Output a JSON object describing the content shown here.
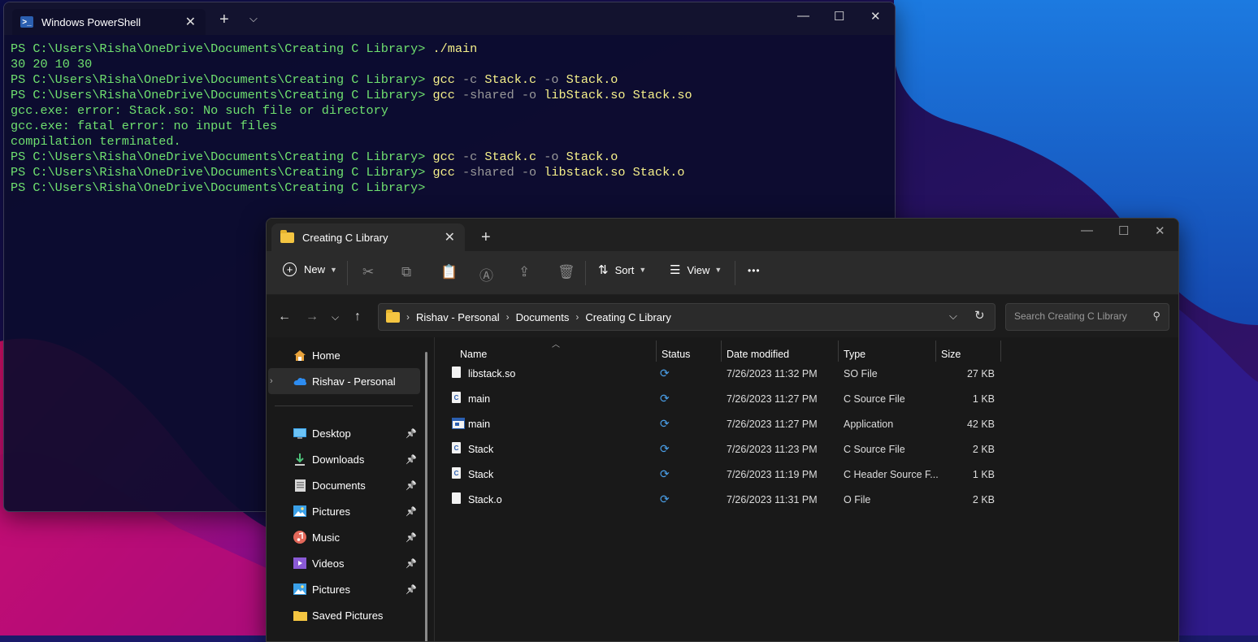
{
  "terminal": {
    "tab_title": "Windows PowerShell",
    "new_tab_glyph": "+",
    "dropdown_glyph": "⌵",
    "lines": [
      {
        "prompt": "PS C:\\Users\\Risha\\OneDrive\\Documents\\Creating C Library> ",
        "cmd": "./main",
        "args": ""
      },
      {
        "prompt": "30 20 10 30",
        "cmd": "",
        "args": ""
      },
      {
        "prompt": "PS C:\\Users\\Risha\\OneDrive\\Documents\\Creating C Library> ",
        "cmd": "gcc",
        "args": " -c Stack.c -o Stack.o"
      },
      {
        "prompt": "PS C:\\Users\\Risha\\OneDrive\\Documents\\Creating C Library> ",
        "cmd": "gcc",
        "args": " -shared -o libStack.so Stack.so"
      },
      {
        "prompt": "gcc.exe: error: Stack.so: No such file or directory",
        "cmd": "",
        "args": ""
      },
      {
        "prompt": "gcc.exe: fatal error: no input files",
        "cmd": "",
        "args": ""
      },
      {
        "prompt": "compilation terminated.",
        "cmd": "",
        "args": ""
      },
      {
        "prompt": "PS C:\\Users\\Risha\\OneDrive\\Documents\\Creating C Library> ",
        "cmd": "gcc",
        "args": " -c Stack.c -o Stack.o"
      },
      {
        "prompt": "PS C:\\Users\\Risha\\OneDrive\\Documents\\Creating C Library> ",
        "cmd": "gcc",
        "args": " -shared -o libstack.so Stack.o"
      },
      {
        "prompt": "PS C:\\Users\\Risha\\OneDrive\\Documents\\Creating C Library> ",
        "cmd": "",
        "args": ""
      }
    ]
  },
  "explorer": {
    "tab_title": "Creating C Library",
    "toolbar": {
      "new_label": "New",
      "sort_label": "Sort",
      "view_label": "View",
      "more_glyph": "•••"
    },
    "breadcrumb": [
      "Rishav - Personal",
      "Documents",
      "Creating C Library"
    ],
    "search_placeholder": "Search Creating C Library",
    "sidebar": {
      "top": [
        {
          "label": "Home",
          "icon": "home-icon"
        },
        {
          "label": "Rishav - Personal",
          "icon": "onedrive-cloud-icon"
        }
      ],
      "quick": [
        {
          "label": "Desktop",
          "icon": "desktop-icon"
        },
        {
          "label": "Downloads",
          "icon": "download-icon"
        },
        {
          "label": "Documents",
          "icon": "documents-icon"
        },
        {
          "label": "Pictures",
          "icon": "pictures-icon"
        },
        {
          "label": "Music",
          "icon": "music-icon"
        },
        {
          "label": "Videos",
          "icon": "videos-icon"
        },
        {
          "label": "Pictures",
          "icon": "pictures-icon"
        },
        {
          "label": "Saved Pictures",
          "icon": "folder-icon"
        }
      ]
    },
    "columns": {
      "name": "Name",
      "status": "Status",
      "date": "Date modified",
      "type": "Type",
      "size": "Size"
    },
    "files": [
      {
        "name": "libstack.so",
        "icon": "file-icon",
        "date": "7/26/2023 11:32 PM",
        "type": "SO File",
        "size": "27 KB"
      },
      {
        "name": "main",
        "icon": "c-source-icon",
        "date": "7/26/2023 11:27 PM",
        "type": "C Source File",
        "size": "1 KB"
      },
      {
        "name": "main",
        "icon": "application-icon",
        "date": "7/26/2023 11:27 PM",
        "type": "Application",
        "size": "42 KB"
      },
      {
        "name": "Stack",
        "icon": "c-source-icon",
        "date": "7/26/2023 11:23 PM",
        "type": "C Source File",
        "size": "2 KB"
      },
      {
        "name": "Stack",
        "icon": "c-header-icon",
        "date": "7/26/2023 11:19 PM",
        "type": "C Header Source F...",
        "size": "1 KB"
      },
      {
        "name": "Stack.o",
        "icon": "file-icon",
        "date": "7/26/2023 11:31 PM",
        "type": "O File",
        "size": "2 KB"
      }
    ]
  }
}
